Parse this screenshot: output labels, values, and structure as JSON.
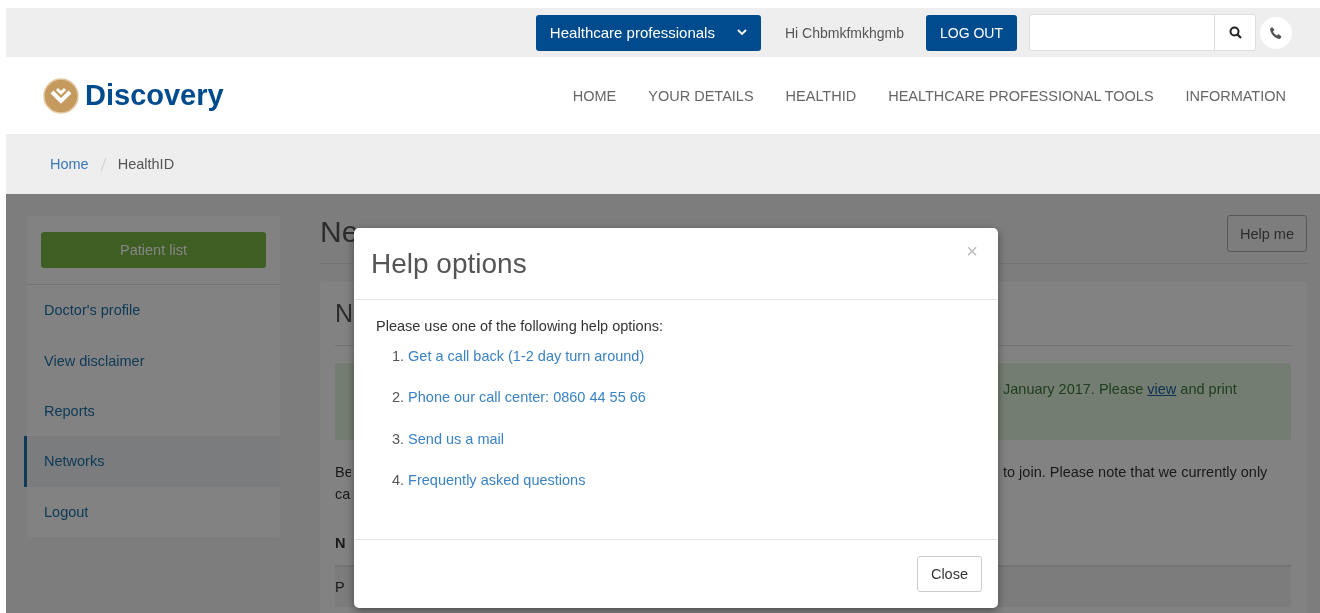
{
  "top_bar": {
    "audience_dropdown": "Healthcare professionals",
    "greeting": "Hi Chbmkfmkhgmb",
    "logout_button": "LOG OUT"
  },
  "header": {
    "logo_text": "Discovery",
    "nav": [
      "HOME",
      "YOUR DETAILS",
      "HEALTHID",
      "HEALTHCARE PROFESSIONAL TOOLS",
      "INFORMATION"
    ]
  },
  "breadcrumb": [
    "Home",
    "HealthID"
  ],
  "sidebar": {
    "button": "Patient list",
    "items": [
      {
        "label": "Doctor's profile",
        "selected": false
      },
      {
        "label": "View disclaimer",
        "selected": false
      },
      {
        "label": "Reports",
        "selected": false
      },
      {
        "label": "Networks",
        "selected": true
      },
      {
        "label": "Logout",
        "selected": false
      }
    ]
  },
  "main": {
    "title_fragment": "Ne",
    "help_button": "Help me",
    "card_title_fragment": "N",
    "alert": {
      "text_before": "January 2017. Please ",
      "link": "view",
      "text_after": " and print"
    },
    "paragraph_left": [
      "Be",
      "ca"
    ],
    "paragraph_right": "to join. Please note that we currently only",
    "table_header_fragment": "N",
    "table_row_fragment": "P"
  },
  "modal": {
    "title": "Help options",
    "close_symbol": "×",
    "intro": "Please use one of the following help options:",
    "options": [
      {
        "number": "1.",
        "text": "Get a call back (1-2 day turn around)"
      },
      {
        "number": "2.",
        "text": "Phone our call center: 0860 44 55 66"
      },
      {
        "number": "3.",
        "text": "Send us a mail"
      },
      {
        "number": "4.",
        "text": "Frequently asked questions"
      }
    ],
    "close_button": "Close"
  }
}
